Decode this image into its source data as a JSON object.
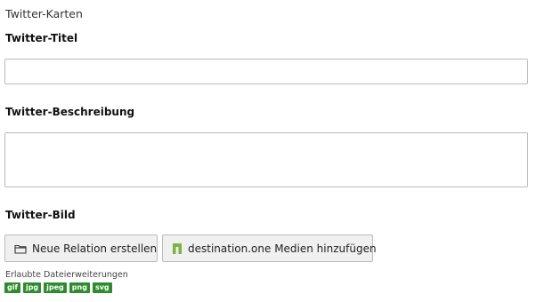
{
  "section": {
    "title": "Twitter-Karten"
  },
  "fields": {
    "title_label": "Twitter-Titel",
    "title_value": "",
    "description_label": "Twitter-Beschreibung",
    "description_value": "",
    "image_label": "Twitter-Bild"
  },
  "buttons": {
    "new_relation": "Neue Relation erstellen",
    "new_relation_icon": "folder-icon",
    "destination_media": "destination.one Medien hinzufügen",
    "destination_media_icon": "destination-one-logo-icon"
  },
  "extensions": {
    "label": "Erlaubte Dateierweiterungen",
    "items": [
      "gif",
      "jpg",
      "jpeg",
      "png",
      "svg"
    ],
    "badge_color": "#2e8b2e"
  },
  "colors": {
    "destination_brand": "#7cb342"
  }
}
